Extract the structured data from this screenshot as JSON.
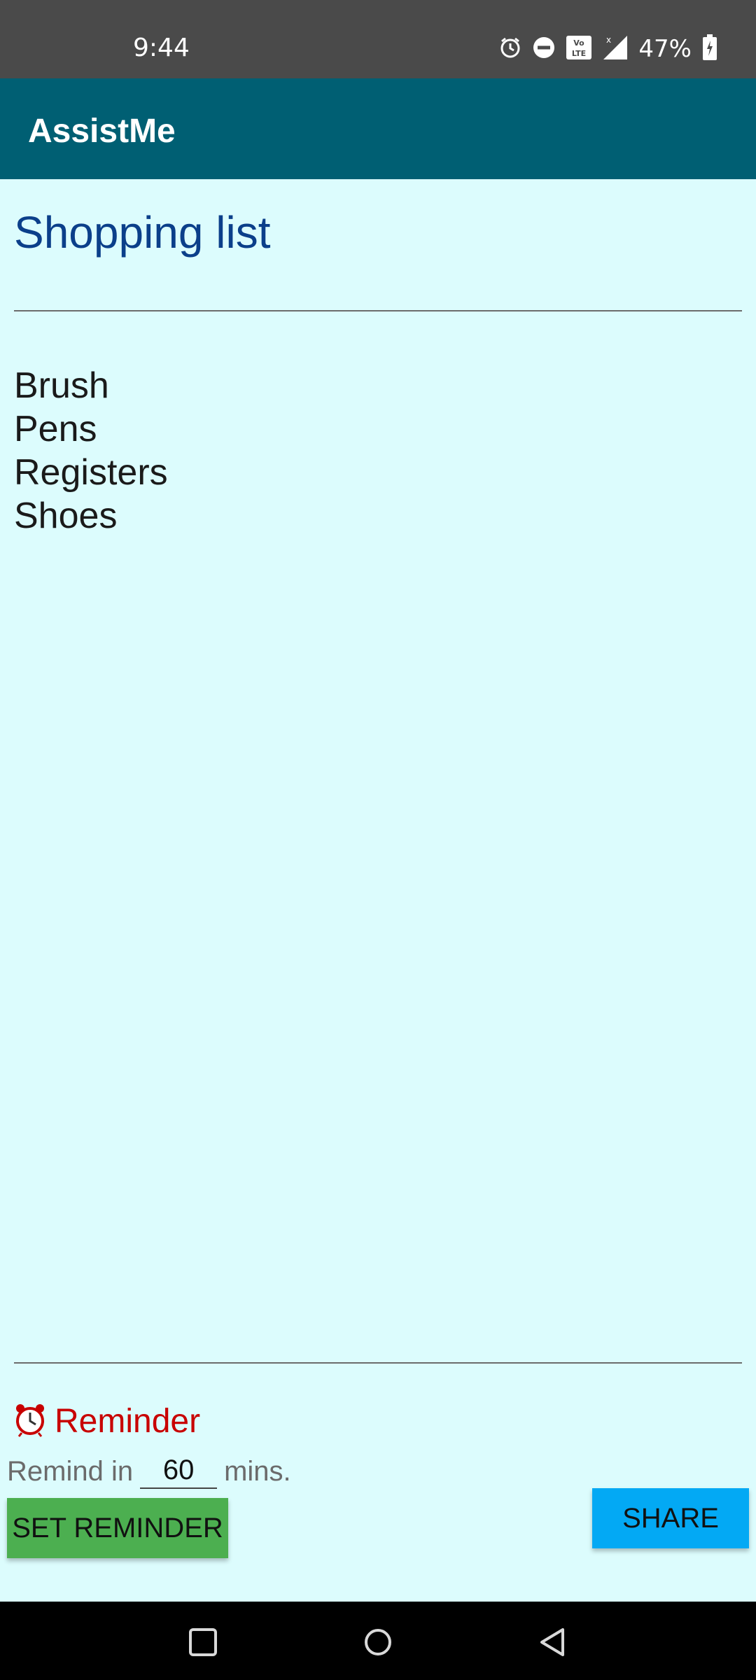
{
  "status_bar": {
    "time": "9:44",
    "battery": "47%",
    "icons": [
      "alarm-icon",
      "do-not-disturb-icon",
      "volte-icon",
      "signal-icon",
      "battery-icon"
    ]
  },
  "app_bar": {
    "title": "AssistMe"
  },
  "list": {
    "title": "Shopping list",
    "items": [
      "Brush",
      "Pens",
      "Registers",
      "Shoes"
    ]
  },
  "reminder": {
    "icon": "alarm-clock-icon",
    "label": "Reminder",
    "prefix": "Remind in",
    "value": "60",
    "suffix": "mins.",
    "set_button": "SET REMINDER",
    "share_button": "SHARE"
  },
  "nav_bar": {
    "icons": [
      "recent-apps-icon",
      "home-icon",
      "back-icon"
    ]
  },
  "colors": {
    "app_bar": "#005f73",
    "background": "#dcfcfd",
    "title": "#0b3f8a",
    "reminder": "#c80000",
    "set_button": "#4caf50",
    "share_button": "#03a9f4"
  }
}
